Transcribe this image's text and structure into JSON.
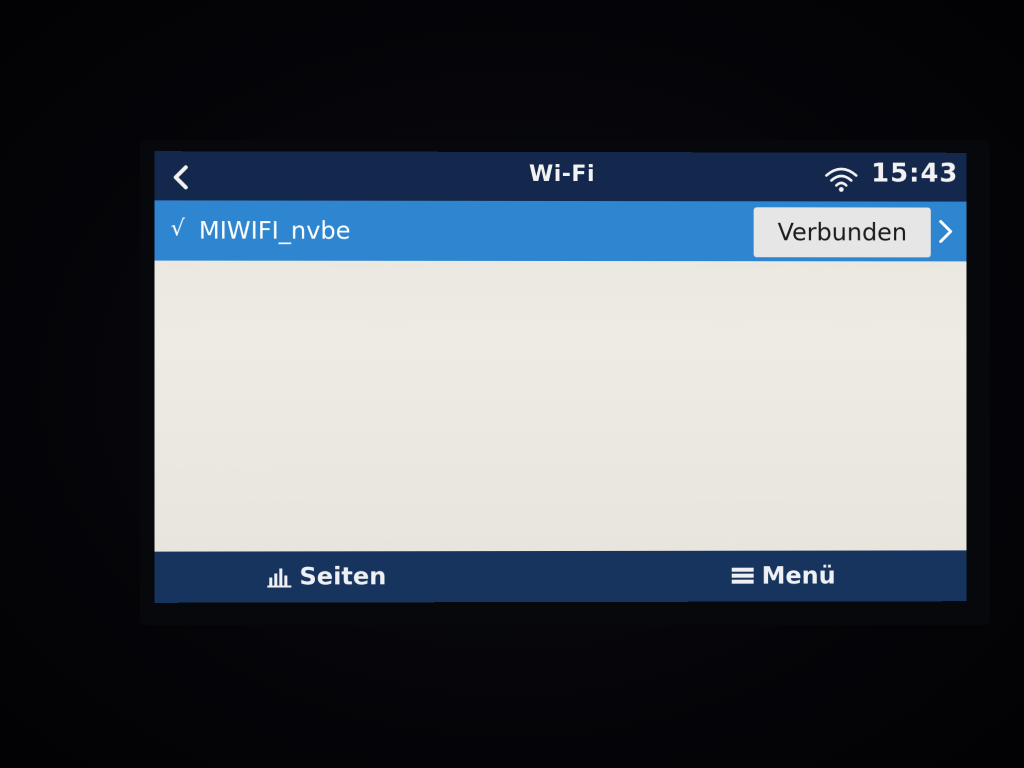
{
  "header": {
    "title": "Wi-Fi",
    "time": "15:43",
    "back_icon": "chevron-left-icon",
    "wifi_icon": "wifi-icon"
  },
  "networks": [
    {
      "check": "√",
      "name": "MIWIFI_nvbe",
      "status": "Verbunden"
    }
  ],
  "footer": {
    "pages_label": "Seiten",
    "pages_icon": "bar-chart-icon",
    "menu_label": "Menü",
    "menu_icon": "hamburger-menu-icon"
  },
  "colors": {
    "header_bg": "#13284c",
    "selected_row": "#2f86d0",
    "list_bg": "#ebe8e1",
    "footer_bg": "#16345e",
    "badge_bg": "#e6e6e6"
  }
}
